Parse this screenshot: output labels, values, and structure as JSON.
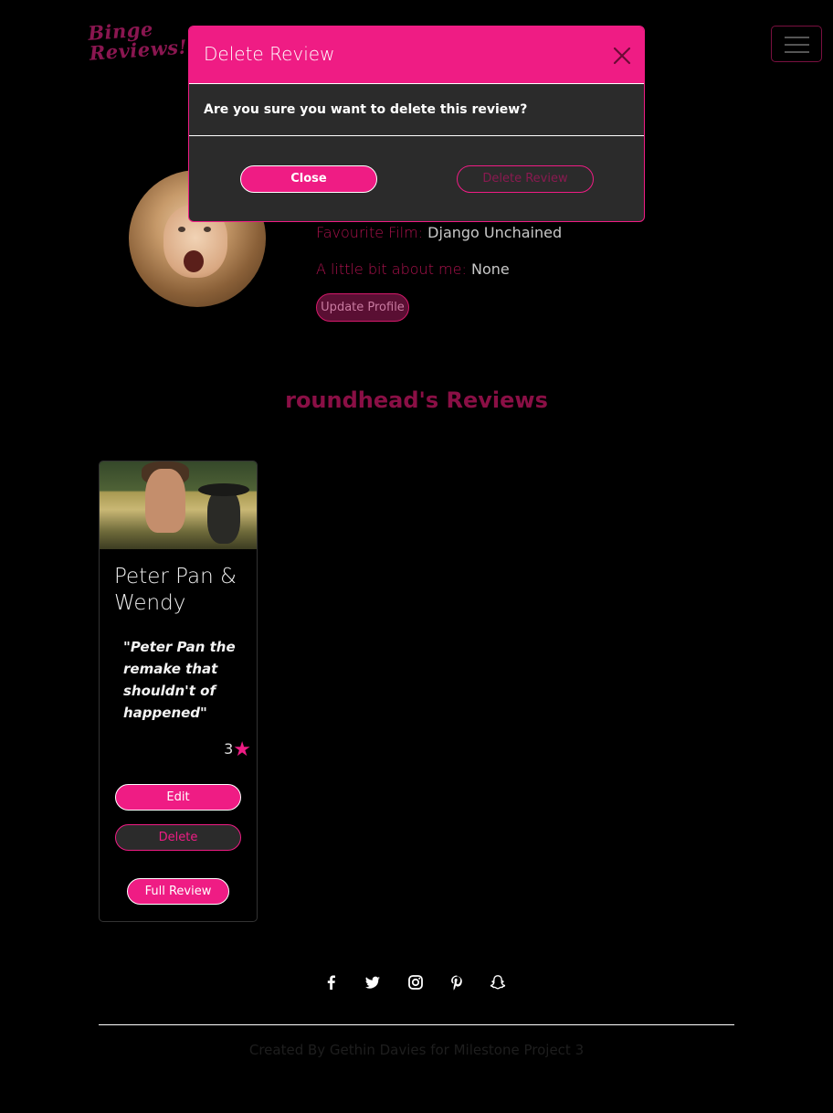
{
  "navbar": {
    "logo_line1": "Binge",
    "logo_line2": "Reviews!",
    "toggler_icon": "hamburger-menu-icon"
  },
  "profile": {
    "favourite_film_label": "Favourite Film:",
    "favourite_film_value": "Django Unchained",
    "about_label": "A little bit about me:",
    "about_value": "None",
    "update_button": "Update Profile"
  },
  "reviews": {
    "heading": "roundhead's Reviews",
    "cards": [
      {
        "title": "Peter Pan & Wendy",
        "quote": "\"Peter Pan the remake that shouldn't of happened\"",
        "rating": "3",
        "rating_icon": "star-icon",
        "edit_label": "Edit",
        "delete_label": "Delete",
        "full_review_label": "Full Review"
      }
    ]
  },
  "footer": {
    "socials": [
      "facebook-icon",
      "twitter-icon",
      "instagram-icon",
      "pinterest-icon",
      "snapchat-icon"
    ],
    "credit": "Created By Gethin Davies for Milestone Project 3"
  },
  "modal": {
    "title": "Delete Review",
    "message": "Are you sure you want to delete this review?",
    "close_label": "Close",
    "confirm_label": "Delete Review"
  },
  "colors": {
    "accent": "#ef1c84",
    "background": "#000000",
    "modal_body": "#2b2b2b"
  }
}
